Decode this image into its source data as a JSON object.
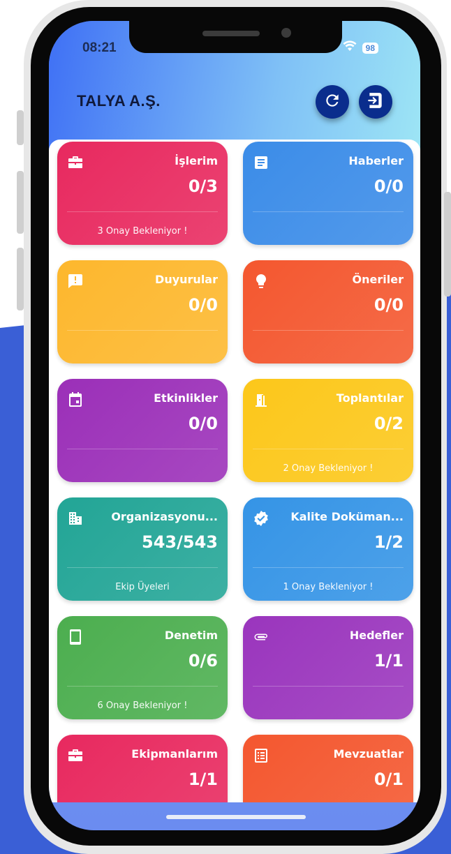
{
  "status_bar": {
    "time": "08:21",
    "battery": "98"
  },
  "header": {
    "title": "TALYA A.Ş.",
    "refresh_icon": "refresh-icon",
    "logout_icon": "logout-icon",
    "accent_color": "#0a2d8d"
  },
  "cards": [
    {
      "title": "İşlerim",
      "count": "0/3",
      "note": "3 Onay Bekleniyor !",
      "icon": "briefcase-icon",
      "color": "#e8295f"
    },
    {
      "title": "Haberler",
      "count": "0/0",
      "note": "",
      "icon": "article-icon",
      "color": "#3b8ce8"
    },
    {
      "title": "Duyurular",
      "count": "0/0",
      "note": "",
      "icon": "announcement-icon",
      "color": "#fdb72d"
    },
    {
      "title": "Öneriler",
      "count": "0/0",
      "note": "",
      "icon": "lightbulb-icon",
      "color": "#f4572f"
    },
    {
      "title": "Etkinlikler",
      "count": "0/0",
      "note": "",
      "icon": "calendar-icon",
      "color": "#9b2fb8"
    },
    {
      "title": "Toplantılar",
      "count": "0/2",
      "note": "2 Onay Bekleniyor !",
      "icon": "door-icon",
      "color": "#fcc71a"
    },
    {
      "title": "Organizasyonu...",
      "count": "543/543",
      "note": "Ekip Üyeleri",
      "icon": "building-icon",
      "color": "#22a596"
    },
    {
      "title": "Kalite Doküman...",
      "count": "1/2",
      "note": "1 Onay Bekleniyor !",
      "icon": "verified-icon",
      "color": "#3594e6"
    },
    {
      "title": "Denetim",
      "count": "0/6",
      "note": "6 Onay Bekleniyor !",
      "icon": "tablet-icon",
      "color": "#4cae4f"
    },
    {
      "title": "Hedefler",
      "count": "1/1",
      "note": "",
      "icon": "paperclip-icon",
      "color": "#9a35bd"
    },
    {
      "title": "Ekipmanlarım",
      "count": "1/1",
      "note": "",
      "icon": "briefcase-icon",
      "color": "#e8295f"
    },
    {
      "title": "Mevzuatlar",
      "count": "0/1",
      "note": "",
      "icon": "list-icon",
      "color": "#f4572f"
    }
  ]
}
